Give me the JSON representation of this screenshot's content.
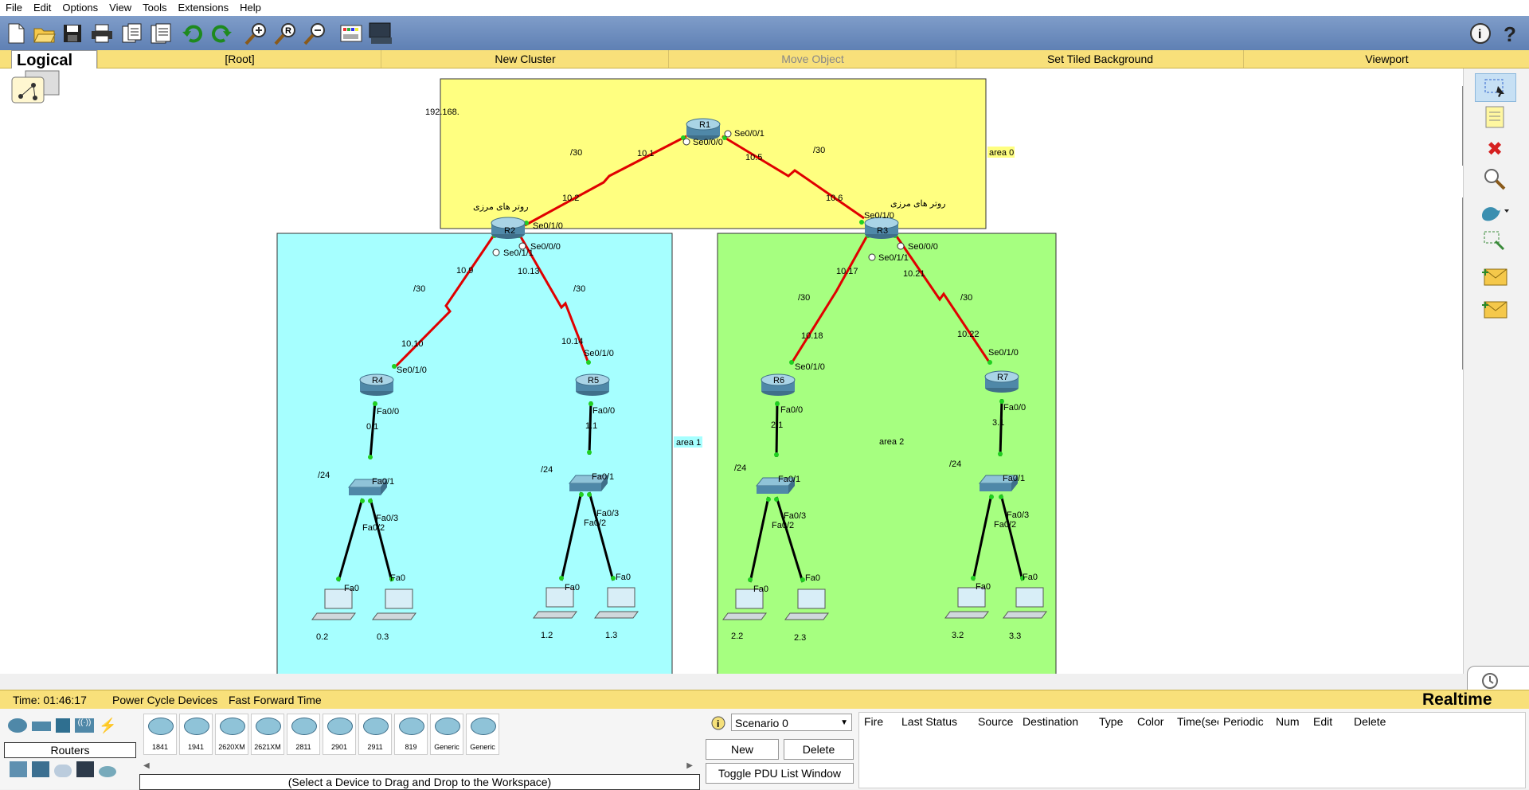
{
  "menu": [
    "File",
    "Edit",
    "Options",
    "View",
    "Tools",
    "Extensions",
    "Help"
  ],
  "logical_bar": {
    "tab": "Logical",
    "items": [
      "[Root]",
      "New Cluster",
      "Move Object",
      "Set Tiled Background",
      "Viewport"
    ]
  },
  "topology": {
    "areas": [
      {
        "name": "area 0",
        "color": "#ffff80"
      },
      {
        "name": "area 1",
        "color": "#a6ffff"
      },
      {
        "name": "area 2",
        "color": "#a6ff80"
      }
    ],
    "network_label": "192.168.",
    "border_router_label": "روتر های مرزی",
    "routers": [
      "R1",
      "R2",
      "R3",
      "R4",
      "R5",
      "R6",
      "R7"
    ],
    "link_labels": [
      "10.1",
      "10.2",
      "10.5",
      "10.6",
      "10.9",
      "10.10",
      "10.13",
      "10.14",
      "10.17",
      "10.18",
      "10.21",
      "10.22",
      "/30",
      "/30",
      "/30",
      "/30",
      "/30",
      "/30",
      "/24",
      "/24",
      "/24",
      "/24"
    ],
    "interfaces": {
      "r1": [
        "Se0/0/1",
        "Se0/0/0"
      ],
      "r2": [
        "Se0/1/0",
        "Se0/0/0",
        "Se0/1/1"
      ],
      "r3": [
        "Se0/1/0",
        "Se0/0/0",
        "Se0/1/1"
      ],
      "r4": [
        "Se0/1/0",
        "Fa0/0"
      ],
      "r5": [
        "Se0/1/0",
        "Fa0/0"
      ],
      "r6": [
        "Se0/1/0",
        "Fa0/0"
      ],
      "r7": [
        "Se0/1/0",
        "Fa0/0"
      ],
      "switch_ports": [
        "Fa0/1",
        "Fa0/3",
        "Fa0/2"
      ],
      "pc_port": "Fa0"
    },
    "lan_gateways": [
      "0.1",
      "1.1",
      "2.1",
      "3.1"
    ],
    "pcs": [
      "0.2",
      "0.3",
      "1.2",
      "1.3",
      "2.2",
      "2.3",
      "3.2",
      "3.3"
    ]
  },
  "status": {
    "time": "Time: 01:46:17",
    "power_cycle": "Power Cycle Devices",
    "fast_forward": "Fast Forward Time",
    "mode": "Realtime"
  },
  "device_panel": {
    "category": "Routers",
    "devices": [
      "1841",
      "1941",
      "2620XM",
      "2621XM",
      "2811",
      "2901",
      "2911",
      "819",
      "Generic",
      "Generic"
    ],
    "hint": "(Select a Device to Drag and Drop to the Workspace)"
  },
  "pdu_panel": {
    "scenario": "Scenario 0",
    "new_label": "New",
    "delete_label": "Delete",
    "toggle_label": "Toggle PDU List Window",
    "columns": [
      "Fire",
      "Last Status",
      "Source",
      "Destination",
      "Type",
      "Color",
      "Time(sec)",
      "Periodic",
      "Num",
      "Edit",
      "Delete"
    ]
  }
}
